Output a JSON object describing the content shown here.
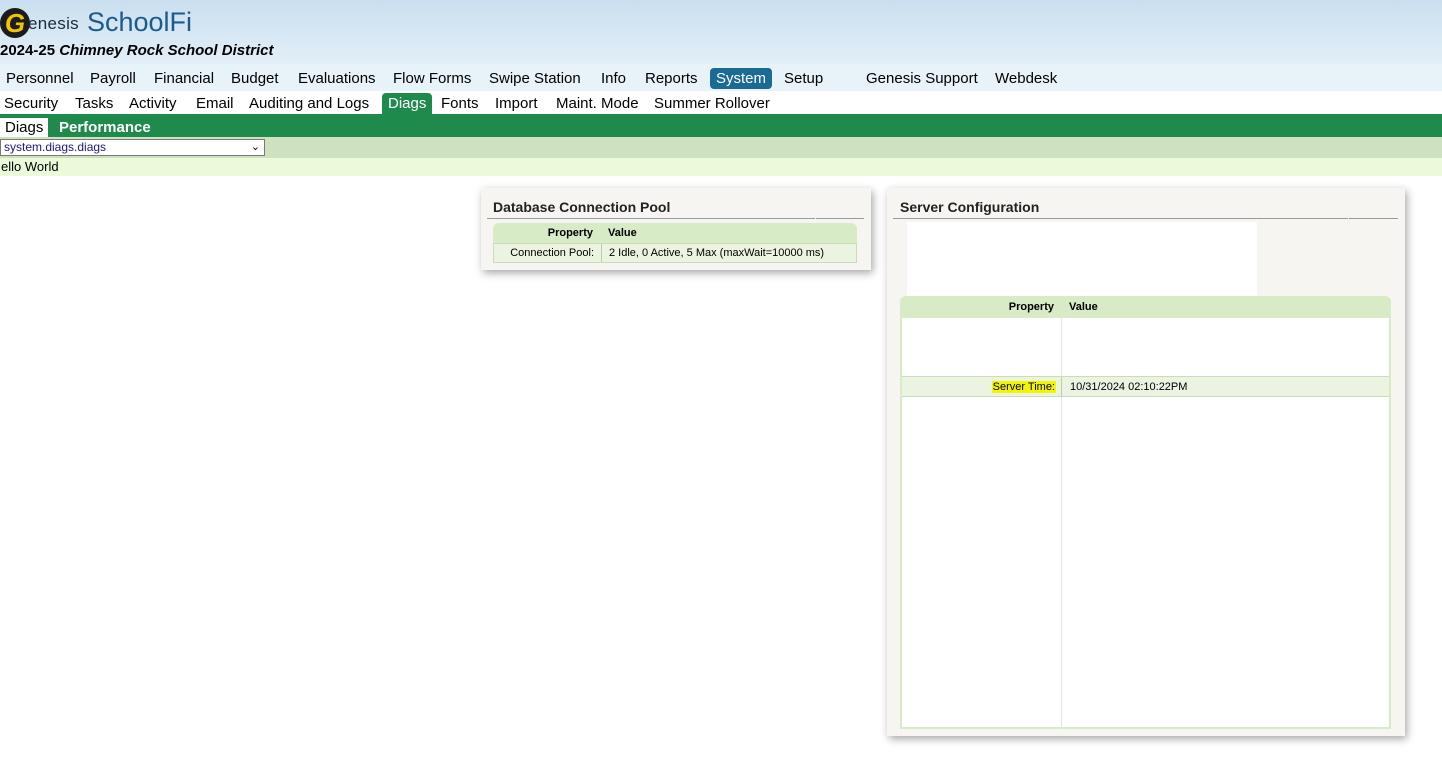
{
  "app": {
    "logo_letter": "G",
    "logo_word": "enesis",
    "product": "SchoolFi",
    "year": "2024-25",
    "district": "Chimney Rock School District"
  },
  "top_menu": [
    {
      "label": "Personnel",
      "active": false
    },
    {
      "label": "Payroll",
      "active": false
    },
    {
      "label": "Financial",
      "active": false
    },
    {
      "label": "Budget",
      "active": false
    },
    {
      "label": "Evaluations",
      "active": false
    },
    {
      "label": "Flow Forms",
      "active": false
    },
    {
      "label": "Swipe Station",
      "active": false
    },
    {
      "label": "Info",
      "active": false
    },
    {
      "label": "Reports",
      "active": false
    },
    {
      "label": "System",
      "active": true
    },
    {
      "label": "Setup",
      "active": false
    },
    {
      "label": "Genesis Support",
      "active": false
    },
    {
      "label": "Webdesk",
      "active": false
    }
  ],
  "sub_menu": [
    {
      "label": "Security",
      "active": false
    },
    {
      "label": "Tasks",
      "active": false
    },
    {
      "label": "Activity",
      "active": false
    },
    {
      "label": "Email",
      "active": false
    },
    {
      "label": "Auditing and Logs",
      "active": false
    },
    {
      "label": "Diags",
      "active": true
    },
    {
      "label": "Fonts",
      "active": false
    },
    {
      "label": "Import",
      "active": false
    },
    {
      "label": "Maint. Mode",
      "active": false
    },
    {
      "label": "Summer Rollover",
      "active": false
    }
  ],
  "tabs": [
    {
      "label": "Diags",
      "active": true
    },
    {
      "label": "Performance",
      "active": false
    }
  ],
  "selector": {
    "value": "system.diags.diags",
    "chevron": "⌄"
  },
  "message": "ello World",
  "db_pool": {
    "title": "Database Connection Pool",
    "col_property": "Property",
    "col_value": "Value",
    "row_property": "Connection Pool:",
    "row_value": "2 Idle, 0 Active, 5 Max (maxWait=10000 ms)"
  },
  "server_config": {
    "title": "Server Configuration",
    "col_property": "Property",
    "col_value": "Value",
    "row_property": "Server Time:",
    "row_value": "10/31/2024 02:10:22PM"
  },
  "colors": {
    "header_blue": "#1c5a8c",
    "menu_active": "#1a6a94",
    "green_bar": "#1e8a4c",
    "highlight": "#f4f400"
  }
}
